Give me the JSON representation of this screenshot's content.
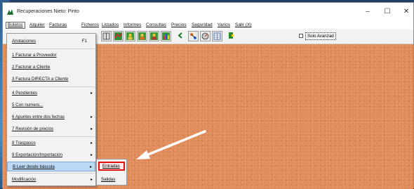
{
  "window": {
    "title": "Recuperaciones Nieto: Pinto",
    "controls": [
      "–",
      "☐",
      "✕"
    ]
  },
  "menubar": {
    "items": [
      {
        "label": "Boletos"
      },
      {
        "label": "Alquiler"
      },
      {
        "label": "Facturas"
      },
      {
        "label": "Ficheros"
      },
      {
        "label": "Listados"
      },
      {
        "label": "Informes"
      },
      {
        "label": "Consultas"
      },
      {
        "label": "Precios"
      },
      {
        "label": "Seguridad"
      },
      {
        "label": "Varios"
      },
      {
        "label": "Salir (X)"
      }
    ]
  },
  "toolbar": {
    "icons": [
      "book-icon",
      "map-icon",
      "people-1-icon",
      "people-2-icon",
      "people-3-icon",
      "chart-icon",
      "arrow-back-icon",
      "network-icon",
      "scale-icon",
      "grid-icon",
      "exit-icon"
    ],
    "checkbox_label": "Solo Avanzad"
  },
  "dropdown": {
    "items": [
      {
        "label": "Anotaciones",
        "shortcut": "F1",
        "arrow": ""
      },
      {
        "label": "1 Facturar a Proveedor",
        "shortcut": "",
        "arrow": ""
      },
      {
        "label": "2 Facturar a Cliente",
        "shortcut": "",
        "arrow": ""
      },
      {
        "label": "3 Factura DIRECTA a Cliente",
        "shortcut": "",
        "arrow": ""
      },
      {
        "label": "4 Pendientes",
        "shortcut": "",
        "arrow": "▸"
      },
      {
        "label": "5 Con numero...",
        "shortcut": "",
        "arrow": ""
      },
      {
        "label": "6 Apuntes entre dos fechas",
        "shortcut": "",
        "arrow": "▸"
      },
      {
        "label": "7 Revisión de precios",
        "shortcut": "",
        "arrow": "▸"
      },
      {
        "label": "8 Traspasos",
        "shortcut": "",
        "arrow": "▸"
      },
      {
        "label": "9 Exportación/Importación",
        "shortcut": "",
        "arrow": "▸"
      },
      {
        "label": "B Leer desde báscula",
        "shortcut": "",
        "arrow": "▸"
      },
      {
        "label": "Modificación",
        "shortcut": "",
        "arrow": "▸"
      }
    ]
  },
  "submenu": {
    "entradas": "Entradas",
    "salidas": "Salidas"
  },
  "colors": {
    "workspace": "#e08a58",
    "highlight": "#bcd7f2",
    "callout_border": "#e01010",
    "arrow": "#ffffff"
  }
}
